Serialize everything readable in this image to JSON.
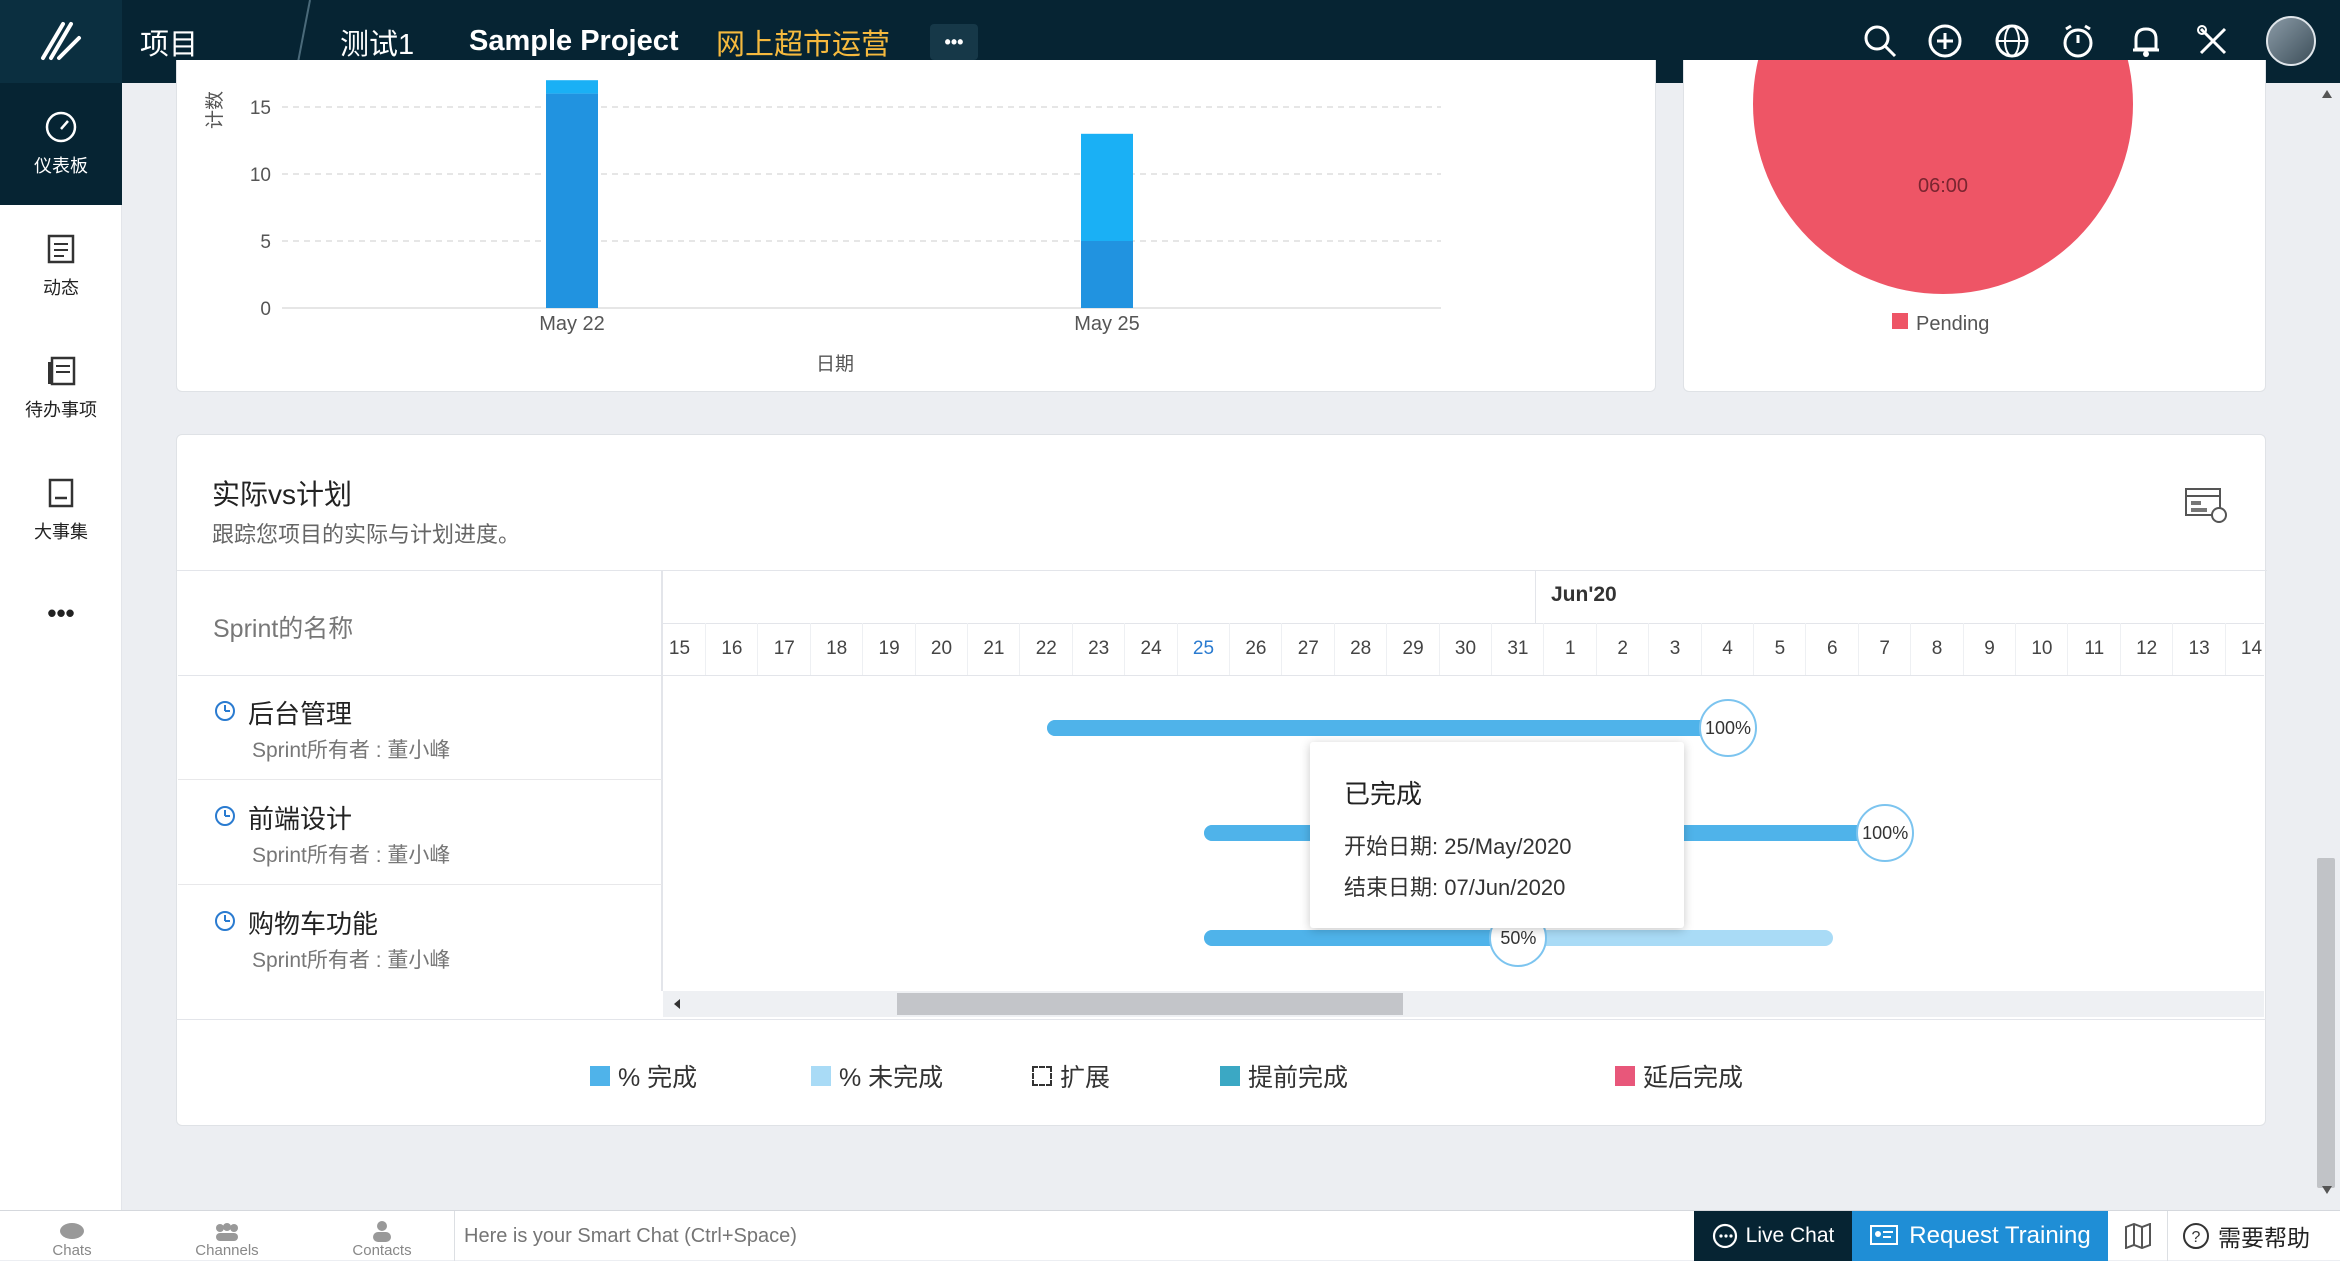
{
  "topbar": {
    "nav_projects": "项目",
    "breadcrumb_portal": "测试1",
    "breadcrumb_project": "Sample Project",
    "breadcrumb_current": "网上超市运营",
    "more": "•••"
  },
  "sidebar": {
    "items": [
      {
        "label": "仪表板",
        "icon": "dashboard-icon"
      },
      {
        "label": "动态",
        "icon": "feed-icon"
      },
      {
        "label": "待办事项",
        "icon": "backlog-icon"
      },
      {
        "label": "大事集",
        "icon": "epic-icon"
      }
    ],
    "more": "•••"
  },
  "bar_chart": {
    "ylabel": "计数",
    "xlabel": "日期",
    "yticks": [
      "15",
      "10",
      "5",
      "0"
    ],
    "xticks": [
      "May 22",
      "May 25"
    ]
  },
  "chart_data": [
    {
      "type": "bar",
      "categories": [
        "May 22",
        "May 25"
      ],
      "series": [
        {
          "values": [
            16,
            5
          ],
          "color": "#2193e0"
        },
        {
          "values": [
            1,
            8
          ],
          "color": "#1ab0f5"
        }
      ],
      "xlabel": "日期",
      "ylabel": "计数",
      "ylim": [
        0,
        15
      ],
      "grid": true
    },
    {
      "type": "pie",
      "labels": [
        "Pending"
      ],
      "values": [
        1
      ],
      "slice_label": "06:00",
      "colors": [
        "#ee5566"
      ],
      "legend": "bottom"
    }
  ],
  "pie_chart": {
    "slice_label": "06:00",
    "legend": "Pending",
    "color": "#ee5566"
  },
  "gantt": {
    "title": "实际vs计划",
    "subtitle": "跟踪您项目的实际与计划进度。",
    "column_header": "Sprint的名称",
    "month_label": "Jun'20",
    "dates": [
      "15",
      "16",
      "17",
      "18",
      "19",
      "20",
      "21",
      "22",
      "23",
      "24",
      "25",
      "26",
      "27",
      "28",
      "29",
      "30",
      "31",
      "1",
      "2",
      "3",
      "4",
      "5",
      "6",
      "7",
      "8",
      "9",
      "10",
      "11",
      "12",
      "13",
      "14"
    ],
    "today_index": 10,
    "sprints": [
      {
        "name": "后台管理",
        "owner": "Sprint所有者 : 董小峰",
        "start_index": 7,
        "end_index": 20,
        "percent_label": "100%",
        "progress": 1.0
      },
      {
        "name": "前端设计",
        "owner": "Sprint所有者 : 董小峰",
        "start_index": 10,
        "end_index": 23,
        "percent_label": "100%",
        "progress": 1.0
      },
      {
        "name": "购物车功能",
        "owner": "Sprint所有者 : 董小峰",
        "start_index": 10,
        "end_index": 22,
        "percent_label": "50%",
        "progress": 0.5
      }
    ],
    "tooltip": {
      "title": "已完成",
      "start": "开始日期: 25/May/2020",
      "end": "结束日期: 07/Jun/2020"
    },
    "legend": [
      {
        "label": "% 完成",
        "color": "#4fb3ea"
      },
      {
        "label": "% 未完成",
        "color": "#a9dbf6"
      },
      {
        "label": "扩展",
        "color": "none"
      },
      {
        "label": "提前完成",
        "color": "#3ba8c4"
      },
      {
        "label": "延后完成",
        "color": "#e8577a"
      }
    ]
  },
  "bottombar": {
    "tabs": [
      "Chats",
      "Channels",
      "Contacts"
    ],
    "smart_chat_placeholder": "Here is your Smart Chat (Ctrl+Space)",
    "live_chat": "Live Chat",
    "request_training": "Request Training",
    "help": "需要帮助"
  }
}
